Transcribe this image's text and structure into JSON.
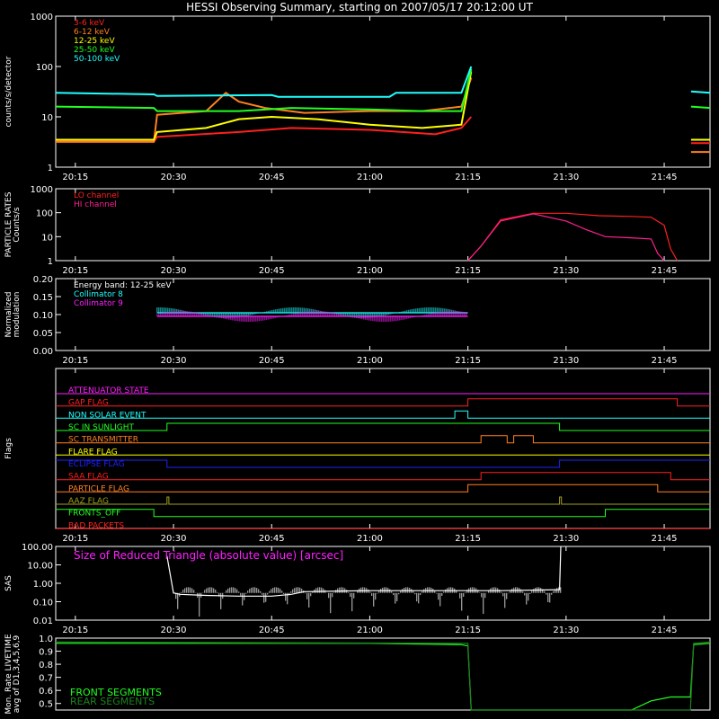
{
  "title": "HESSI Observing Summary, starting on 2007/05/17 20:12:00 UT",
  "time_ticks": [
    "20:15",
    "20:30",
    "20:45",
    "21:00",
    "21:15",
    "21:30",
    "21:45"
  ],
  "colors": {
    "red": "#ff2020",
    "orange": "#ff8020",
    "yellow": "#ffff00",
    "green": "#20ff20",
    "cyan": "#20ffff",
    "magenta": "#ff20ff",
    "lo": "#ff2020",
    "hi": "#ff2090",
    "blue": "#2020ff",
    "olive": "#a0a020",
    "front": "#20ff20",
    "rear": "#208020"
  },
  "chart_data": [
    {
      "type": "line",
      "panel": "count-rates",
      "ylabel": "counts/s/detector",
      "yscale": "log",
      "ylim": [
        1,
        1000
      ],
      "ytick_labels": [
        "1",
        "10",
        "100",
        "1000"
      ],
      "xlim": [
        "20:12",
        "21:52"
      ],
      "series": [
        {
          "name": "3-6 keV",
          "color": "red",
          "x": [
            "20:12",
            "20:27",
            "20:27.5",
            "20:40",
            "20:48",
            "21:00",
            "21:05",
            "21:10",
            "21:14",
            "21:15.5",
            "21:15.6",
            "21:49",
            "21:49.1",
            "21:52"
          ],
          "y": [
            3.2,
            3.2,
            4,
            5,
            6,
            5.5,
            5,
            4.5,
            6,
            10,
            null,
            null,
            3,
            3
          ]
        },
        {
          "name": "6-12 keV",
          "color": "orange",
          "x": [
            "20:12",
            "20:27",
            "20:27.5",
            "20:35",
            "20:38",
            "20:40",
            "20:44",
            "20:50",
            "21:00",
            "21:08",
            "21:14",
            "21:15.5",
            "21:15.6",
            "21:49",
            "21:49.1",
            "21:52"
          ],
          "y": [
            3.2,
            3.2,
            11,
            13,
            30,
            20,
            15,
            12,
            13,
            13,
            16,
            60,
            null,
            null,
            2,
            2
          ]
        },
        {
          "name": "12-25 keV",
          "color": "yellow",
          "x": [
            "20:12",
            "20:27",
            "20:27.5",
            "20:35",
            "20:40",
            "20:45",
            "20:52",
            "21:00",
            "21:08",
            "21:14",
            "21:15.5",
            "21:15.6",
            "21:49",
            "21:49.1",
            "21:52"
          ],
          "y": [
            3.5,
            3.5,
            5,
            6,
            9,
            10,
            9,
            7,
            6,
            7,
            80,
            null,
            null,
            3.5,
            3.5
          ]
        },
        {
          "name": "25-50 keV",
          "color": "green",
          "x": [
            "20:12",
            "20:27",
            "20:27.5",
            "20:40",
            "20:48",
            "21:00",
            "21:08",
            "21:14",
            "21:15.5",
            "21:15.6",
            "21:49",
            "21:49.1",
            "21:52"
          ],
          "y": [
            16,
            15,
            13,
            13,
            15,
            14,
            13,
            13,
            90,
            null,
            null,
            16,
            15
          ]
        },
        {
          "name": "50-100 keV",
          "color": "cyan",
          "x": [
            "20:12",
            "20:27",
            "20:27.5",
            "20:45",
            "20:46",
            "21:03",
            "21:04",
            "21:14",
            "21:15.5",
            "21:15.6",
            "21:49",
            "21:49.1",
            "21:52"
          ],
          "y": [
            30,
            28,
            26,
            27,
            25,
            25,
            30,
            30,
            100,
            null,
            null,
            32,
            30
          ]
        }
      ]
    },
    {
      "type": "line",
      "panel": "particle-rates",
      "ylabel": "PARTICLE RATES Counts/s",
      "yscale": "log",
      "ylim": [
        1,
        1000
      ],
      "ytick_labels": [
        "1",
        "10",
        "100",
        "1000"
      ],
      "series": [
        {
          "name": "LO channel",
          "color": "lo",
          "x": [
            "21:15",
            "21:17",
            "21:20",
            "21:25",
            "21:30",
            "21:35",
            "21:40",
            "21:43",
            "21:45",
            "21:46",
            "21:47"
          ],
          "y": [
            1,
            4,
            50,
            95,
            95,
            75,
            70,
            65,
            30,
            3,
            1
          ]
        },
        {
          "name": "HI channel",
          "color": "hi",
          "x": [
            "21:15",
            "21:17",
            "21:20",
            "21:25",
            "21:30",
            "21:33",
            "21:36",
            "21:40",
            "21:43",
            "21:44",
            "21:45"
          ],
          "y": [
            1,
            4,
            45,
            90,
            45,
            20,
            10,
            9,
            8,
            2,
            1
          ]
        }
      ]
    },
    {
      "type": "line",
      "panel": "modulation",
      "ylabel": "Normalized modulation",
      "ylim": [
        0,
        0.2
      ],
      "ytick_labels": [
        "0.00",
        "0.05",
        "0.10",
        "0.15",
        "0.20"
      ],
      "annotation": "Energy band: 12-25 keV",
      "series": [
        {
          "name": "Collimator 8",
          "color": "cyan",
          "x": [
            "20:27.5",
            "21:15"
          ],
          "y": [
            0.105,
            0.105
          ]
        },
        {
          "name": "Collimator 9",
          "color": "magenta",
          "x": [
            "20:27.5",
            "21:15"
          ],
          "y": [
            0.095,
            0.095
          ]
        }
      ]
    },
    {
      "type": "line",
      "panel": "flags",
      "ylabel": "Flags",
      "series": [
        {
          "name": "ATTENUATOR STATE",
          "color": "magenta",
          "x": [
            "20:12",
            "21:52"
          ],
          "y": [
            0,
            0
          ]
        },
        {
          "name": "GAP FLAG",
          "color": "red",
          "x": [
            "20:12",
            "21:15",
            "21:15",
            "21:47",
            "21:47",
            "21:52"
          ],
          "y": [
            0,
            0,
            1,
            1,
            0,
            0
          ]
        },
        {
          "name": "NON SOLAR EVENT",
          "color": "cyan",
          "x": [
            "20:12",
            "21:13",
            "21:13",
            "21:15",
            "21:15",
            "21:52"
          ],
          "y": [
            0,
            0,
            1,
            1,
            0,
            0
          ]
        },
        {
          "name": "SC IN SUNLIGHT",
          "color": "green",
          "x": [
            "20:12",
            "20:29",
            "20:29",
            "21:29",
            "21:29",
            "21:52"
          ],
          "y": [
            0,
            0,
            1,
            1,
            0,
            0
          ]
        },
        {
          "name": "SC TRANSMITTER",
          "color": "orange",
          "x": [
            "20:12",
            "21:17",
            "21:17",
            "21:21",
            "21:21",
            "21:22",
            "21:22",
            "21:25",
            "21:25",
            "21:52"
          ],
          "y": [
            0,
            0,
            1,
            1,
            0,
            0,
            1,
            1,
            0,
            0
          ]
        },
        {
          "name": "FLARE FLAG",
          "color": "yellow",
          "x": [
            "20:12",
            "21:52"
          ],
          "y": [
            0,
            0
          ]
        },
        {
          "name": "ECLIPSE FLAG",
          "color": "blue",
          "x": [
            "20:12",
            "20:29",
            "20:29",
            "21:29",
            "21:29",
            "21:52"
          ],
          "y": [
            1,
            1,
            0,
            0,
            1,
            1
          ]
        },
        {
          "name": "SAA FLAG",
          "color": "red",
          "x": [
            "20:12",
            "21:17",
            "21:17",
            "21:46",
            "21:46",
            "21:52"
          ],
          "y": [
            0,
            0,
            1,
            1,
            0,
            0
          ]
        },
        {
          "name": "PARTICLE FLAG",
          "color": "orange",
          "x": [
            "20:12",
            "21:15",
            "21:15",
            "21:44",
            "21:44",
            "21:52"
          ],
          "y": [
            0,
            0,
            1,
            1,
            0,
            0
          ]
        },
        {
          "name": "AAZ FLAG",
          "color": "olive",
          "x": [
            "20:12",
            "20:29",
            "20:29",
            "20:29.3",
            "20:29.3",
            "21:29",
            "21:29",
            "21:29.3",
            "21:29.3",
            "21:52"
          ],
          "y": [
            0,
            0,
            1,
            1,
            0,
            0,
            1,
            1,
            0,
            0
          ]
        },
        {
          "name": "FRONTS_OFF",
          "color": "green",
          "x": [
            "20:12",
            "20:27",
            "20:27",
            "21:36",
            "21:36",
            "21:52"
          ],
          "y": [
            1,
            1,
            0,
            0,
            1,
            1
          ]
        },
        {
          "name": "BAD PACKETS",
          "color": "red",
          "x": [
            "20:12",
            "21:52"
          ],
          "y": [
            0,
            0
          ]
        }
      ]
    },
    {
      "type": "line",
      "panel": "sas",
      "ylabel": "SAS",
      "yscale": "log",
      "ylim": [
        0.01,
        100
      ],
      "ytick_labels": [
        "0.01",
        "0.10",
        "1.00",
        "10.00",
        "100.00"
      ],
      "annotation": "Size of Reduced Triangle (absolute value) [arcsec]",
      "series": [
        {
          "name": "SAS",
          "color": "white",
          "x": [
            "20:29",
            "20:30",
            "20:31",
            "20:35",
            "20:40",
            "20:45",
            "20:48",
            "20:50",
            "21:00",
            "21:10",
            "21:20",
            "21:29",
            "21:29.2"
          ],
          "y": [
            30,
            0.3,
            0.25,
            0.22,
            0.2,
            0.2,
            0.25,
            0.35,
            0.4,
            0.4,
            0.4,
            0.45,
            100
          ]
        }
      ]
    },
    {
      "type": "line",
      "panel": "livetime",
      "ylabel": "Mon. Rate LIVETIME avg of D1,3,4,5,6,9",
      "ylim": [
        0.45,
        1.0
      ],
      "ytick_labels": [
        "0.5",
        "0.6",
        "0.7",
        "0.8",
        "0.9",
        "1.0"
      ],
      "series": [
        {
          "name": "FRONT SEGMENTS",
          "color": "front",
          "x": [
            "20:12",
            "21:00",
            "21:14",
            "21:15",
            "21:15.5",
            "21:40",
            "21:43",
            "21:46",
            "21:49",
            "21:49.5",
            "21:52"
          ],
          "y": [
            0.96,
            0.96,
            0.95,
            0.94,
            0.45,
            0.45,
            0.52,
            0.55,
            0.55,
            0.95,
            0.96
          ]
        },
        {
          "name": "REAR SEGMENTS",
          "color": "rear",
          "x": [
            "20:12",
            "21:15",
            "21:15.5",
            "21:49",
            "21:49.5",
            "21:52"
          ],
          "y": [
            0.97,
            0.96,
            0.45,
            0.45,
            0.96,
            0.97
          ]
        }
      ]
    }
  ]
}
